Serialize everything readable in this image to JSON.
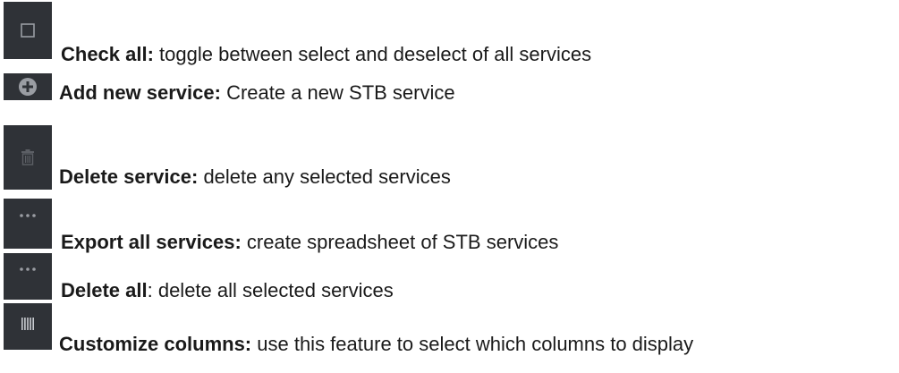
{
  "items": [
    {
      "icon": "checkbox-icon",
      "label": "Check all:",
      "description": " toggle between select and deselect of all services"
    },
    {
      "icon": "plus-circle-icon",
      "label": "Add new service:",
      "description": " Create a new STB service"
    },
    {
      "icon": "trash-icon",
      "label": "Delete service:",
      "description": " delete any selected services"
    },
    {
      "icon": "more-dots-icon",
      "label": "Export all services:",
      "description": " create spreadsheet of STB services"
    },
    {
      "icon": "more-dots-icon",
      "label": "Delete all",
      "description": ": delete all selected services"
    },
    {
      "icon": "columns-icon",
      "label": "Customize columns:",
      "description": " use this feature to select which columns to display"
    }
  ],
  "colors": {
    "tile": "#2f3237",
    "icon": "#9a9da3"
  }
}
